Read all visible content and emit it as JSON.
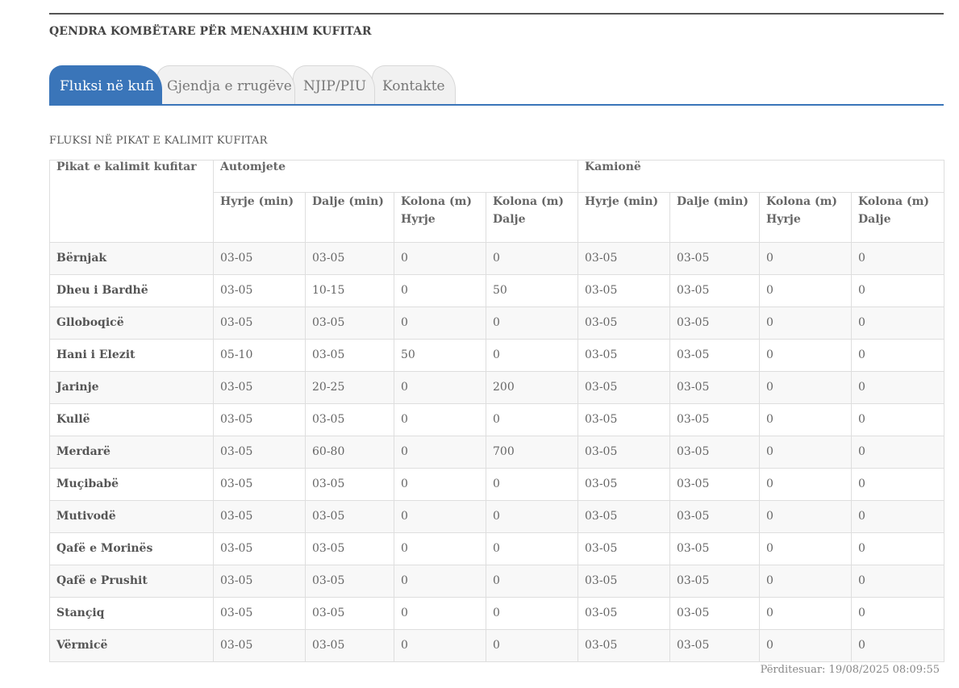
{
  "site_title": "QENDRA KOMBËTARE PËR MENAXHIM KUFITAR",
  "tabs": [
    {
      "label": "Fluksi në kufi",
      "active": true
    },
    {
      "label": "Gjendja e rrugëve",
      "active": false
    },
    {
      "label": "NJIP/PIU",
      "active": false
    },
    {
      "label": "Kontakte",
      "active": false
    }
  ],
  "section_title": "FLUKSI NË PIKAT E KALIMIT KUFITAR",
  "table": {
    "corner_header": "Pikat e kalimit kufitar",
    "groups": [
      "Automjete",
      "Kamionë"
    ],
    "columns": [
      "Hyrje (min)",
      "Dalje (min)",
      "Kolona (m) Hyrje",
      "Kolona (m) Dalje"
    ],
    "rows": [
      {
        "point": "Bërnjak",
        "cells": [
          "03-05",
          "03-05",
          "0",
          "0",
          "03-05",
          "03-05",
          "0",
          "0"
        ]
      },
      {
        "point": "Dheu i Bardhë",
        "cells": [
          "03-05",
          "10-15",
          "0",
          "50",
          "03-05",
          "03-05",
          "0",
          "0"
        ]
      },
      {
        "point": "Glloboqicë",
        "cells": [
          "03-05",
          "03-05",
          "0",
          "0",
          "03-05",
          "03-05",
          "0",
          "0"
        ]
      },
      {
        "point": "Hani i Elezit",
        "cells": [
          "05-10",
          "03-05",
          "50",
          "0",
          "03-05",
          "03-05",
          "0",
          "0"
        ]
      },
      {
        "point": "Jarinje",
        "cells": [
          "03-05",
          "20-25",
          "0",
          "200",
          "03-05",
          "03-05",
          "0",
          "0"
        ]
      },
      {
        "point": "Kullë",
        "cells": [
          "03-05",
          "03-05",
          "0",
          "0",
          "03-05",
          "03-05",
          "0",
          "0"
        ]
      },
      {
        "point": "Merdarë",
        "cells": [
          "03-05",
          "60-80",
          "0",
          "700",
          "03-05",
          "03-05",
          "0",
          "0"
        ]
      },
      {
        "point": "Muçibabë",
        "cells": [
          "03-05",
          "03-05",
          "0",
          "0",
          "03-05",
          "03-05",
          "0",
          "0"
        ]
      },
      {
        "point": "Mutivodë",
        "cells": [
          "03-05",
          "03-05",
          "0",
          "0",
          "03-05",
          "03-05",
          "0",
          "0"
        ]
      },
      {
        "point": "Qafë e Morinës",
        "cells": [
          "03-05",
          "03-05",
          "0",
          "0",
          "03-05",
          "03-05",
          "0",
          "0"
        ]
      },
      {
        "point": "Qafë e Prushit",
        "cells": [
          "03-05",
          "03-05",
          "0",
          "0",
          "03-05",
          "03-05",
          "0",
          "0"
        ]
      },
      {
        "point": "Stançiq",
        "cells": [
          "03-05",
          "03-05",
          "0",
          "0",
          "03-05",
          "03-05",
          "0",
          "0"
        ]
      },
      {
        "point": "Vërmicë",
        "cells": [
          "03-05",
          "03-05",
          "0",
          "0",
          "03-05",
          "03-05",
          "0",
          "0"
        ]
      }
    ]
  },
  "updated": "Përditesuar: 19/08/2025 08:09:55",
  "colors": {
    "accent": "#3a75b9",
    "tab_inactive": "#f1f1f1",
    "row_alt": "#f8f8f8"
  }
}
